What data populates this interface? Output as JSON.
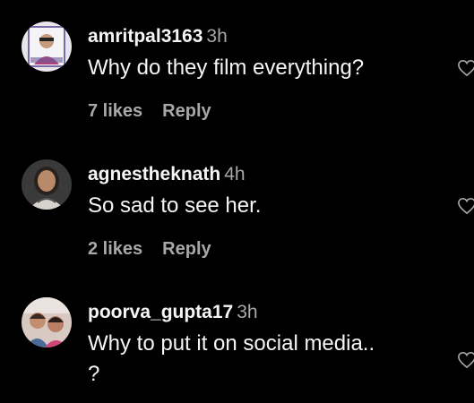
{
  "comments": [
    {
      "username": "amritpal3163",
      "time": "3h",
      "text": "Why do they film everything?",
      "likes": "7 likes",
      "reply": "Reply",
      "avatar_icon": "user-avatar-photo"
    },
    {
      "username": "agnestheknath",
      "time": "4h",
      "text": "So sad to see her.",
      "likes": "2 likes",
      "reply": "Reply",
      "avatar_icon": "user-avatar-photo"
    },
    {
      "username": "poorva_gupta17",
      "time": "3h",
      "text_line1": "Why to put it on social media..",
      "text_line2": "?",
      "avatar_icon": "user-avatar-photo"
    }
  ],
  "icons": {
    "like": "heart-outline-icon"
  },
  "colors": {
    "background": "#000000",
    "primary_text": "#f5f5f5",
    "secondary_text": "#a8a8a8"
  }
}
